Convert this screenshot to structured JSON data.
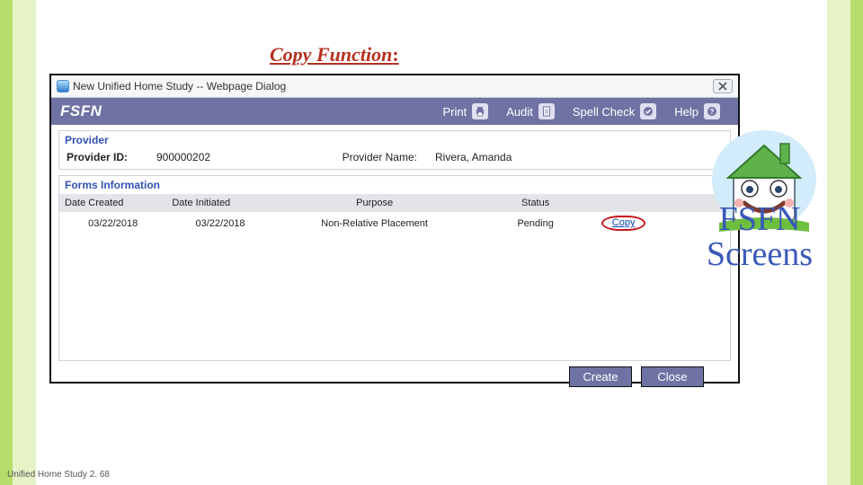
{
  "heading_main": "Copy Function",
  "heading_colon": ":",
  "dialog": {
    "title": "New Unified Home Study -- Webpage Dialog"
  },
  "toolbar": {
    "brand": "FSFN",
    "print": "Print",
    "audit": "Audit",
    "spell": "Spell Check",
    "help": "Help"
  },
  "provider": {
    "legend": "Provider",
    "id_label": "Provider ID:",
    "id_value": "900000202",
    "name_label": "Provider Name:",
    "name_value": "Rivera, Amanda"
  },
  "forms": {
    "legend": "Forms Information",
    "headers": {
      "date_created": "Date Created",
      "date_initiated": "Date Initiated",
      "purpose": "Purpose",
      "status": "Status",
      "action": ""
    },
    "row": {
      "date_created": "03/22/2018",
      "date_initiated": "03/22/2018",
      "purpose": "Non-Relative Placement",
      "status": "Pending",
      "action": "Copy"
    }
  },
  "buttons": {
    "create": "Create",
    "close": "Close"
  },
  "side_label": "FSFN Screens",
  "footer": "Unified Home Study 2. 68"
}
